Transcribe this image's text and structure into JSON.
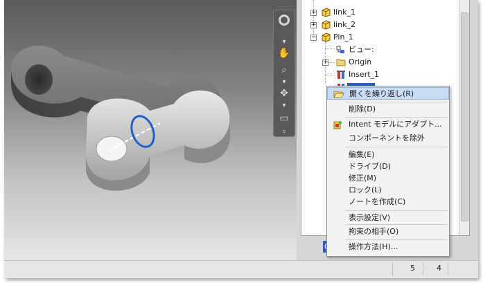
{
  "browser_tree": {
    "items": [
      {
        "label": "link_1"
      },
      {
        "label": "link_2"
      },
      {
        "label": "Pin_1"
      },
      {
        "label": "ビュー:"
      },
      {
        "label": "Origin"
      },
      {
        "label": "Insert_1"
      }
    ]
  },
  "context_menu": {
    "items": [
      {
        "label": "開くを繰り返し(R)"
      },
      {
        "label": "削除(D)"
      },
      {
        "label": "Intent モデルにアダプト..."
      },
      {
        "label": "コンポーネントを除外"
      },
      {
        "label": "編集(E)"
      },
      {
        "label": "ドライブ(D)"
      },
      {
        "label": "修正(M)"
      },
      {
        "label": "ロック(L)"
      },
      {
        "label": "ノートを作成(C)"
      },
      {
        "label": "表示設定(V)"
      },
      {
        "label": "拘束の相手(O)"
      },
      {
        "label": "操作方法(H)..."
      }
    ]
  },
  "value_field": {
    "text": "0.0"
  },
  "statusbar": {
    "cell_1": "5",
    "cell_2": "4"
  },
  "colors": {
    "selection_blue": "#2f5fb0",
    "constraint_ring": "#1f5fc8",
    "folder_yellow": "#f4d34a"
  }
}
